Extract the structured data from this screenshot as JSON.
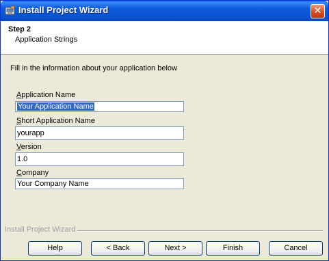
{
  "window": {
    "title": "Install Project Wizard",
    "close_glyph": "✕"
  },
  "header": {
    "step": "Step 2",
    "subtitle": "Application Strings"
  },
  "instructions": "Fill in the information about your application below",
  "fields": [
    {
      "label": "Application Name",
      "accel": "A",
      "value": "Your Application Name",
      "selected": true
    },
    {
      "label": "Short Application Name",
      "accel": "S",
      "value": "yourapp"
    },
    {
      "label": "Version",
      "accel": "V",
      "value": "1.0"
    },
    {
      "label": "Company",
      "accel": "C",
      "value": "Your Company Name"
    }
  ],
  "separator_label": "Install Project Wizard",
  "buttons": {
    "help": "Help",
    "back": "< Back",
    "next": "Next >",
    "finish": "Finish",
    "cancel": "Cancel"
  },
  "icons": {
    "app_icon": "installer-icon",
    "close": "close-icon"
  },
  "colors": {
    "titlebar": "#0B55D3",
    "selection": "#316AC5",
    "face": "#ECE9D8"
  }
}
